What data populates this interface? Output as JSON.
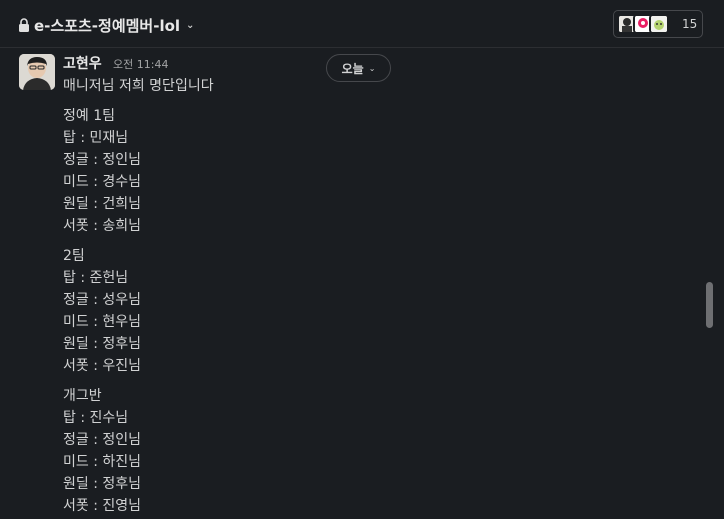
{
  "channel": {
    "name": "e-스포츠-정예멤버-lol",
    "member_count": "15"
  },
  "date_divider": "오늘",
  "message": {
    "author": "고현우",
    "time": "오전 11:44",
    "lines": [
      "매니저님 저희 명단입니다",
      "정예 1팀",
      "탑 : 민재님",
      "정글 : 정인님",
      "미드 : 경수님",
      "원딜 : 건희님",
      "서폿 : 송희님",
      "2팀",
      "탑 : 준헌님",
      "정글 : 성우님",
      "미드 : 현우님",
      "원딜 : 정후님",
      "서폿 : 우진님",
      "개그반",
      "탑 : 진수님",
      "정글 : 정인님",
      "미드 : 하진님",
      "원딜 : 정후님",
      "서폿 : 진영님"
    ]
  },
  "colors": {
    "background": "#1a1d21",
    "text": "#d1d2d3",
    "border": "#46484c"
  }
}
